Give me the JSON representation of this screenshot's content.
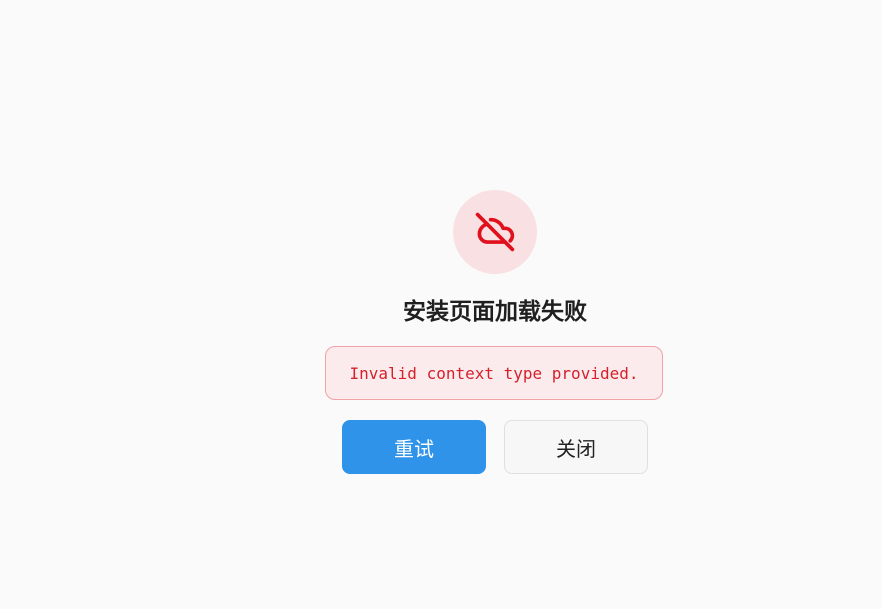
{
  "dialog": {
    "icon": "cloud-off-icon",
    "title": "安装页面加载失败",
    "message": "Invalid context type provided.",
    "retry_label": "重试",
    "close_label": "关闭"
  },
  "colors": {
    "background": "#fafafa",
    "icon_circle": "#f9e0e2",
    "icon_stroke": "#e0101c",
    "message_bg": "#fbebec",
    "message_border": "#f0a3a8",
    "message_text": "#d6202c",
    "primary": "#2f93ea"
  }
}
